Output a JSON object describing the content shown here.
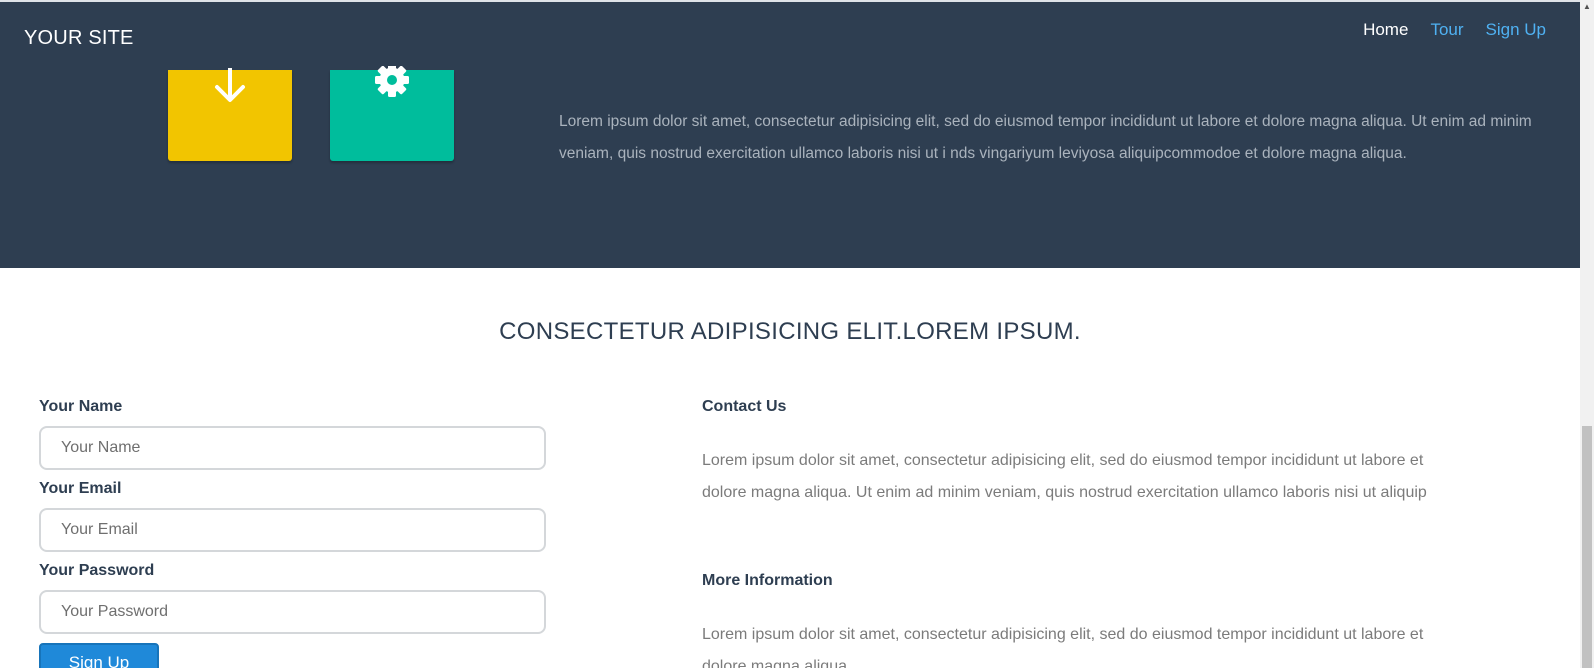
{
  "header": {
    "brand": "YOUR SITE",
    "nav": [
      {
        "label": "Home",
        "active": true
      },
      {
        "label": "Tour",
        "active": false
      },
      {
        "label": "Sign Up",
        "active": false
      }
    ]
  },
  "hero": {
    "tiles": [
      {
        "icon": "download-arrow-icon",
        "color": "#f2c500"
      },
      {
        "icon": "gear-icon",
        "color": "#00bd9c"
      }
    ],
    "text": "Lorem ipsum dolor sit amet, consectetur adipisicing elit, sed do eiusmod tempor incididunt ut labore et dolore magna aliqua. Ut enim ad minim veniam, quis nostrud exercitation ullamco laboris nisi ut i nds vingariyum leviyosa aliquipcommodoe et dolore magna aliqua."
  },
  "main": {
    "title": "CONSECTETUR ADIPISICING ELIT.LOREM IPSUM.",
    "form": {
      "name_label": "Your Name",
      "name_placeholder": "Your Name",
      "email_label": "Your Email",
      "email_placeholder": "Your Email",
      "password_label": "Your Password",
      "password_placeholder": "Your Password",
      "submit_label": "Sign Up"
    },
    "contact": {
      "heading": "Contact Us",
      "text": "Lorem ipsum dolor sit amet, consectetur adipisicing elit, sed do eiusmod tempor incididunt ut labore et dolore magna aliqua. Ut enim ad minim veniam, quis nostrud exercitation ullamco laboris nisi ut aliquip"
    },
    "more": {
      "heading": "More Information",
      "text": "Lorem ipsum dolor sit amet, consectetur adipisicing elit, sed do eiusmod tempor incididunt ut labore et dolore magna aliqua."
    }
  },
  "colors": {
    "hero_bg": "#2e3e51",
    "nav_link": "#4fb1f2",
    "button": "#1f89d9"
  }
}
